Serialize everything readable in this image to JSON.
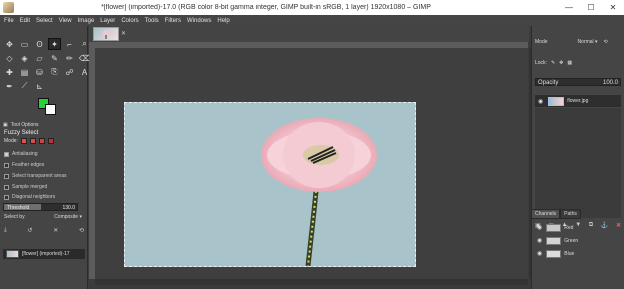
{
  "window": {
    "title": "*[flower] (imported)-17.0 (RGB color 8-bit gamma integer, GIMP built-in sRGB, 1 layer) 1920x1080 – GIMP",
    "minimize": "—",
    "maximize": "☐",
    "close": "✕"
  },
  "menu": [
    "File",
    "Edit",
    "Select",
    "View",
    "Image",
    "Layer",
    "Colors",
    "Tools",
    "Filters",
    "Windows",
    "Help"
  ],
  "tools": [
    {
      "icon": "move-icon",
      "glyph": "✥"
    },
    {
      "icon": "rect-select-icon",
      "glyph": "▭"
    },
    {
      "icon": "lasso-icon",
      "glyph": "ʘ"
    },
    {
      "icon": "fuzzy-select-icon",
      "glyph": "✦"
    },
    {
      "icon": "crop-icon",
      "glyph": "⌐"
    },
    {
      "icon": "zoom-icon",
      "glyph": "⌕"
    },
    {
      "icon": "transform-icon",
      "glyph": "◇"
    },
    {
      "icon": "warp-icon",
      "glyph": "◈"
    },
    {
      "icon": "perspective-icon",
      "glyph": "▱"
    },
    {
      "icon": "paint-icon",
      "glyph": "✎"
    },
    {
      "icon": "pencil-icon",
      "glyph": "✏"
    },
    {
      "icon": "eraser-icon",
      "glyph": "⌫"
    },
    {
      "icon": "heal-icon",
      "glyph": "✚"
    },
    {
      "icon": "blend-icon",
      "glyph": "▤"
    },
    {
      "icon": "bucket-icon",
      "glyph": "⛁"
    },
    {
      "icon": "clone-icon",
      "glyph": "⎘"
    },
    {
      "icon": "smudge-icon",
      "glyph": "☍"
    },
    {
      "icon": "text-icon",
      "glyph": "A"
    },
    {
      "icon": "path-icon",
      "glyph": "✒"
    },
    {
      "icon": "picker-icon",
      "glyph": "⟋"
    },
    {
      "icon": "measure-icon",
      "glyph": "⊾"
    }
  ],
  "colors": {
    "foreground": "#26d13a",
    "background": "#ffffff"
  },
  "tool_options": {
    "tab_label": "Tool Options",
    "title": "Fuzzy Select",
    "mode_label": "Mode:",
    "options": [
      {
        "label": "Antialiasing",
        "checked": true
      },
      {
        "label": "Feather edges",
        "checked": false
      },
      {
        "label": "Select transparent areas",
        "checked": false
      },
      {
        "label": "Sample merged",
        "checked": false
      },
      {
        "label": "Diagonal neighbors",
        "checked": false
      }
    ],
    "threshold_label": "Threshold",
    "threshold_value": "130.0",
    "threshold_fraction": 0.51,
    "select_by_label": "Select by",
    "select_by_value": "Composite"
  },
  "image_tab": {
    "label": "[flower] (imported)-17"
  },
  "layers": {
    "mode_label": "Mode",
    "mode_value": "Normal",
    "opacity_label": "Opacity",
    "opacity_value": "100.0",
    "lock_label": "Lock:",
    "layer_name": "flower.jpg"
  },
  "channels": {
    "tab_channels": "Channels",
    "tab_paths": "Paths",
    "items": [
      "Red",
      "Green",
      "Blue"
    ]
  }
}
